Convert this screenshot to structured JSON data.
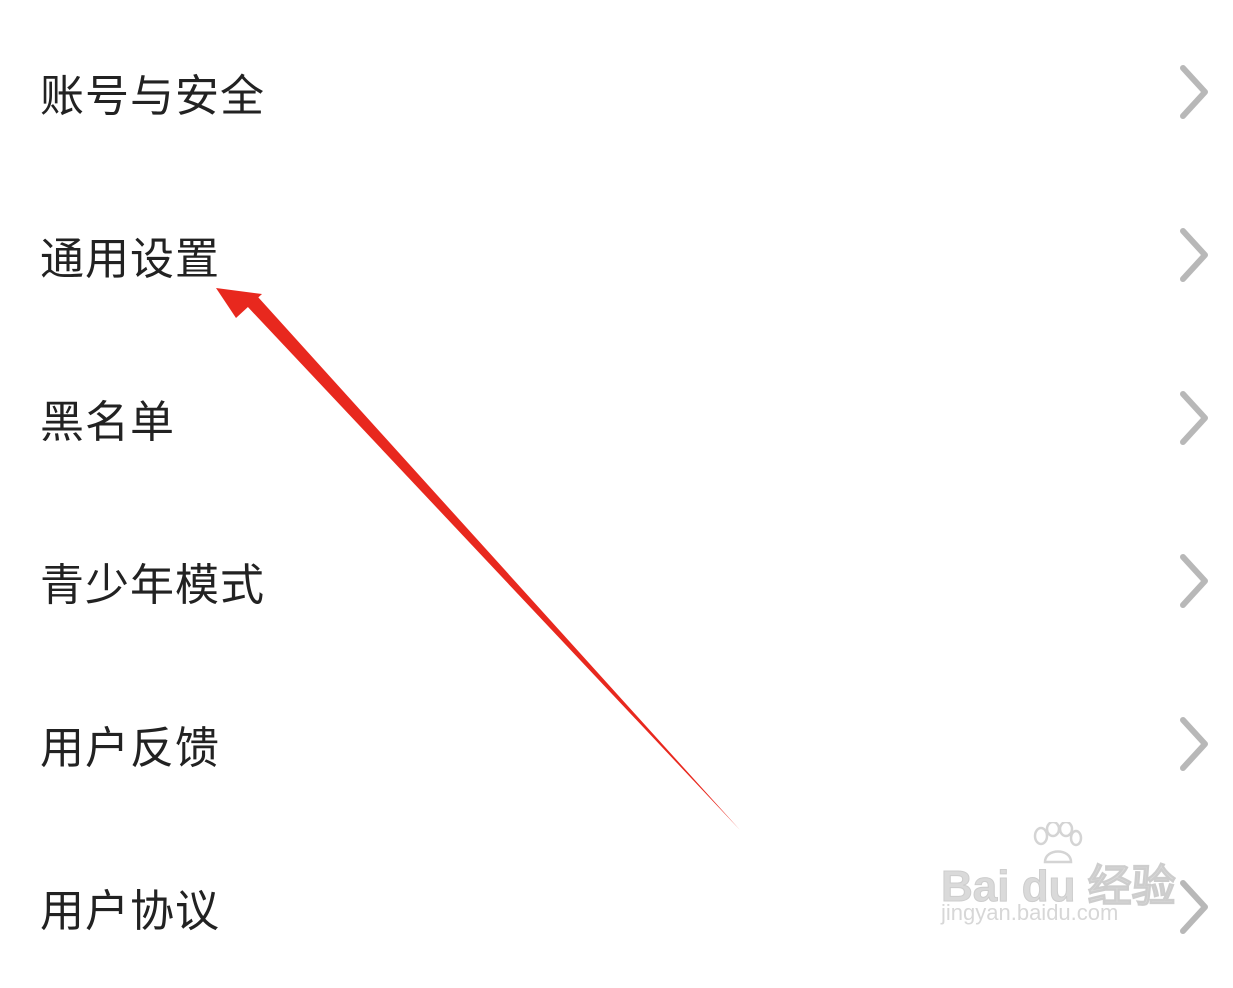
{
  "menu": {
    "items": [
      {
        "label": "账号与安全",
        "icon": "chevron-right-icon"
      },
      {
        "label": "通用设置",
        "icon": "chevron-right-icon"
      },
      {
        "label": "黑名单",
        "icon": "chevron-right-icon"
      },
      {
        "label": "青少年模式",
        "icon": "chevron-right-icon"
      },
      {
        "label": "用户反馈",
        "icon": "chevron-right-icon"
      },
      {
        "label": "用户协议",
        "icon": "chevron-right-icon"
      }
    ]
  },
  "annotation": {
    "color": "#e8281e",
    "points_to": "通用设置"
  },
  "watermark": {
    "brand": "Bai du 经验",
    "url": "jingyan.baidu.com"
  },
  "colors": {
    "text": "#222222",
    "chevron": "#b8b8b8",
    "background": "#ffffff"
  }
}
